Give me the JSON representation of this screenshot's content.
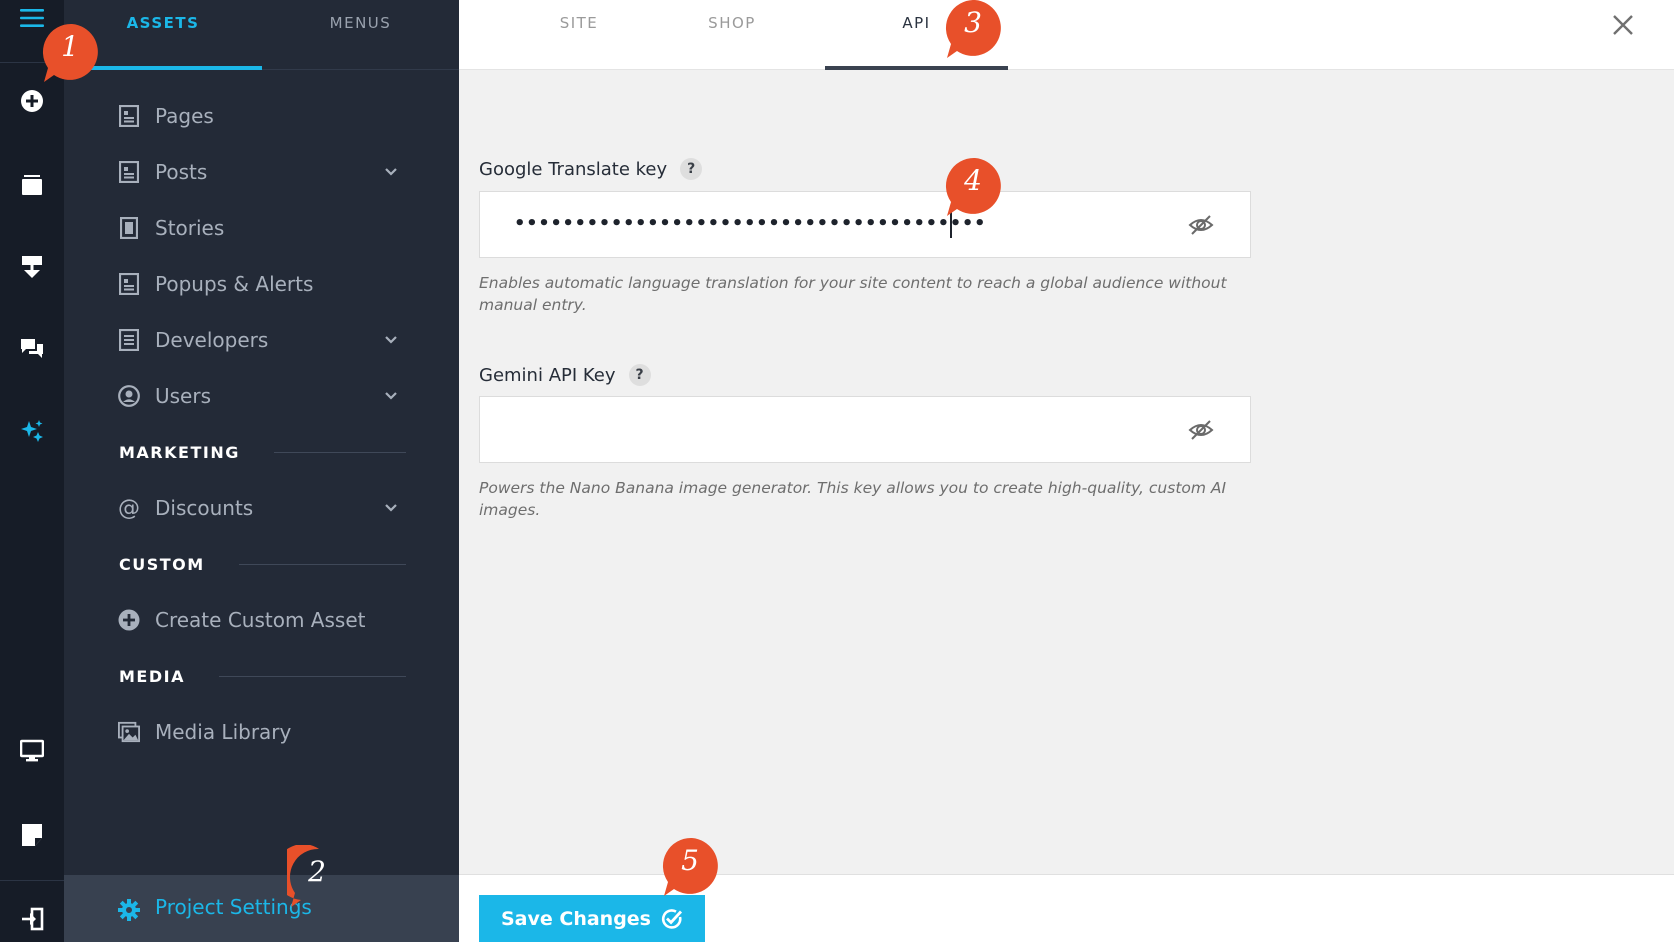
{
  "sidebar": {
    "tabs": [
      {
        "label": "ASSETS",
        "active": true
      },
      {
        "label": "MENUS",
        "active": false
      }
    ],
    "items": [
      {
        "label": "Pages",
        "icon": "page-icon",
        "has_chevron": false
      },
      {
        "label": "Posts",
        "icon": "page-icon",
        "has_chevron": true
      },
      {
        "label": "Stories",
        "icon": "mobile-page-icon",
        "has_chevron": false
      },
      {
        "label": "Popups & Alerts",
        "icon": "page-icon",
        "has_chevron": false
      },
      {
        "label": "Developers",
        "icon": "document-icon",
        "has_chevron": true
      },
      {
        "label": "Users",
        "icon": "user-circle-icon",
        "has_chevron": true
      }
    ],
    "sections": {
      "marketing": "MARKETING",
      "custom": "CUSTOM",
      "media": "MEDIA"
    },
    "marketing_items": [
      {
        "label": "Discounts",
        "icon": "at-icon",
        "has_chevron": true
      }
    ],
    "custom_items": [
      {
        "label": "Create Custom Asset",
        "icon": "plus-circle-icon"
      }
    ],
    "media_items": [
      {
        "label": "Media Library",
        "icon": "images-icon"
      }
    ],
    "settings": {
      "label": "Project Settings",
      "icon": "gear-icon"
    }
  },
  "topbar": {
    "tabs": [
      {
        "label": "SITE",
        "active": false
      },
      {
        "label": "SHOP",
        "active": false
      },
      {
        "label": "API",
        "active": true
      }
    ]
  },
  "form": {
    "google_translate": {
      "label": "Google Translate key",
      "help_badge": "?",
      "value": "•••••••••••••••••••••••••••••••••••••••",
      "help": "Enables automatic language translation for your site content to reach a global audience without manual entry."
    },
    "gemini": {
      "label": "Gemini API Key",
      "help_badge": "?",
      "value": "",
      "help": "Powers the Nano Banana image generator. This key allows you to create high-quality, custom AI images."
    }
  },
  "footer": {
    "save_label": "Save Changes"
  },
  "callouts": [
    "1",
    "2",
    "3",
    "4",
    "5"
  ],
  "colors": {
    "accent": "#1bb7e8",
    "callout": "#e8502a",
    "rail_bg": "#161c27",
    "sidebar_bg": "#232a37"
  }
}
